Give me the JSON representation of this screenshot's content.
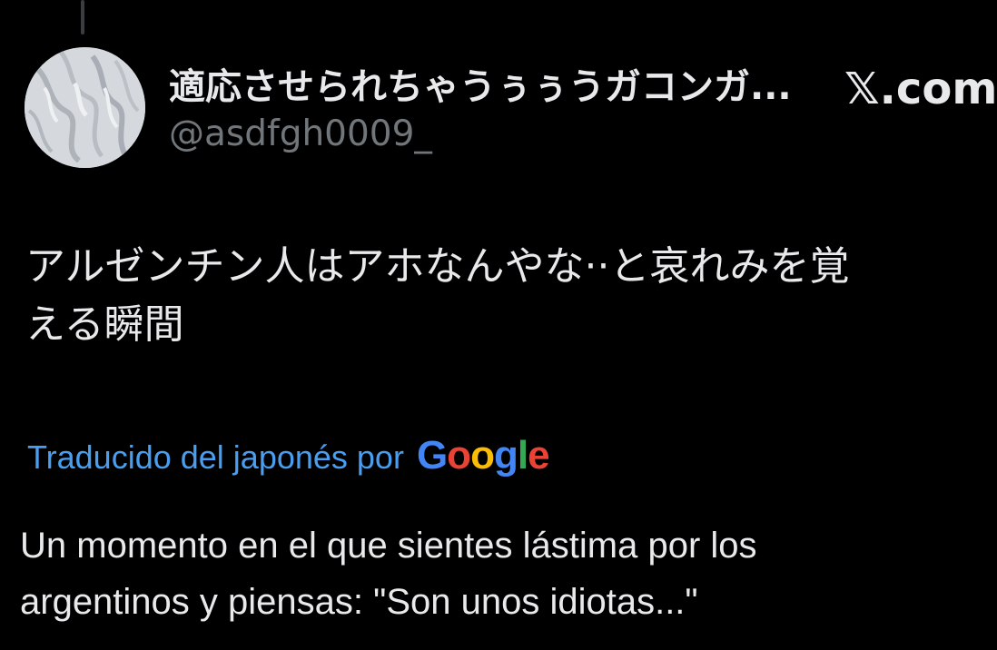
{
  "author": {
    "display_name": "適応させられちゃうぅぅうガコンガ...",
    "handle": "@asdfgh0009_"
  },
  "source_label": "𝕏.com",
  "tweet": {
    "text_lines": [
      "アルゼンチン人はアホなんやな··と哀れみを覚",
      "える瞬間"
    ]
  },
  "translation": {
    "label": "Traducido del japonés por",
    "provider_letters": [
      "G",
      "o",
      "o",
      "g",
      "l",
      "e"
    ],
    "text_lines": [
      "Un momento en el que sientes lástima por los",
      "argentinos y piensas: \"Son unos idiotas...\""
    ]
  },
  "colors": {
    "background": "#000000",
    "primary_text": "#e7e9ea",
    "secondary_text": "#71767b",
    "link": "#4a9ef0"
  }
}
